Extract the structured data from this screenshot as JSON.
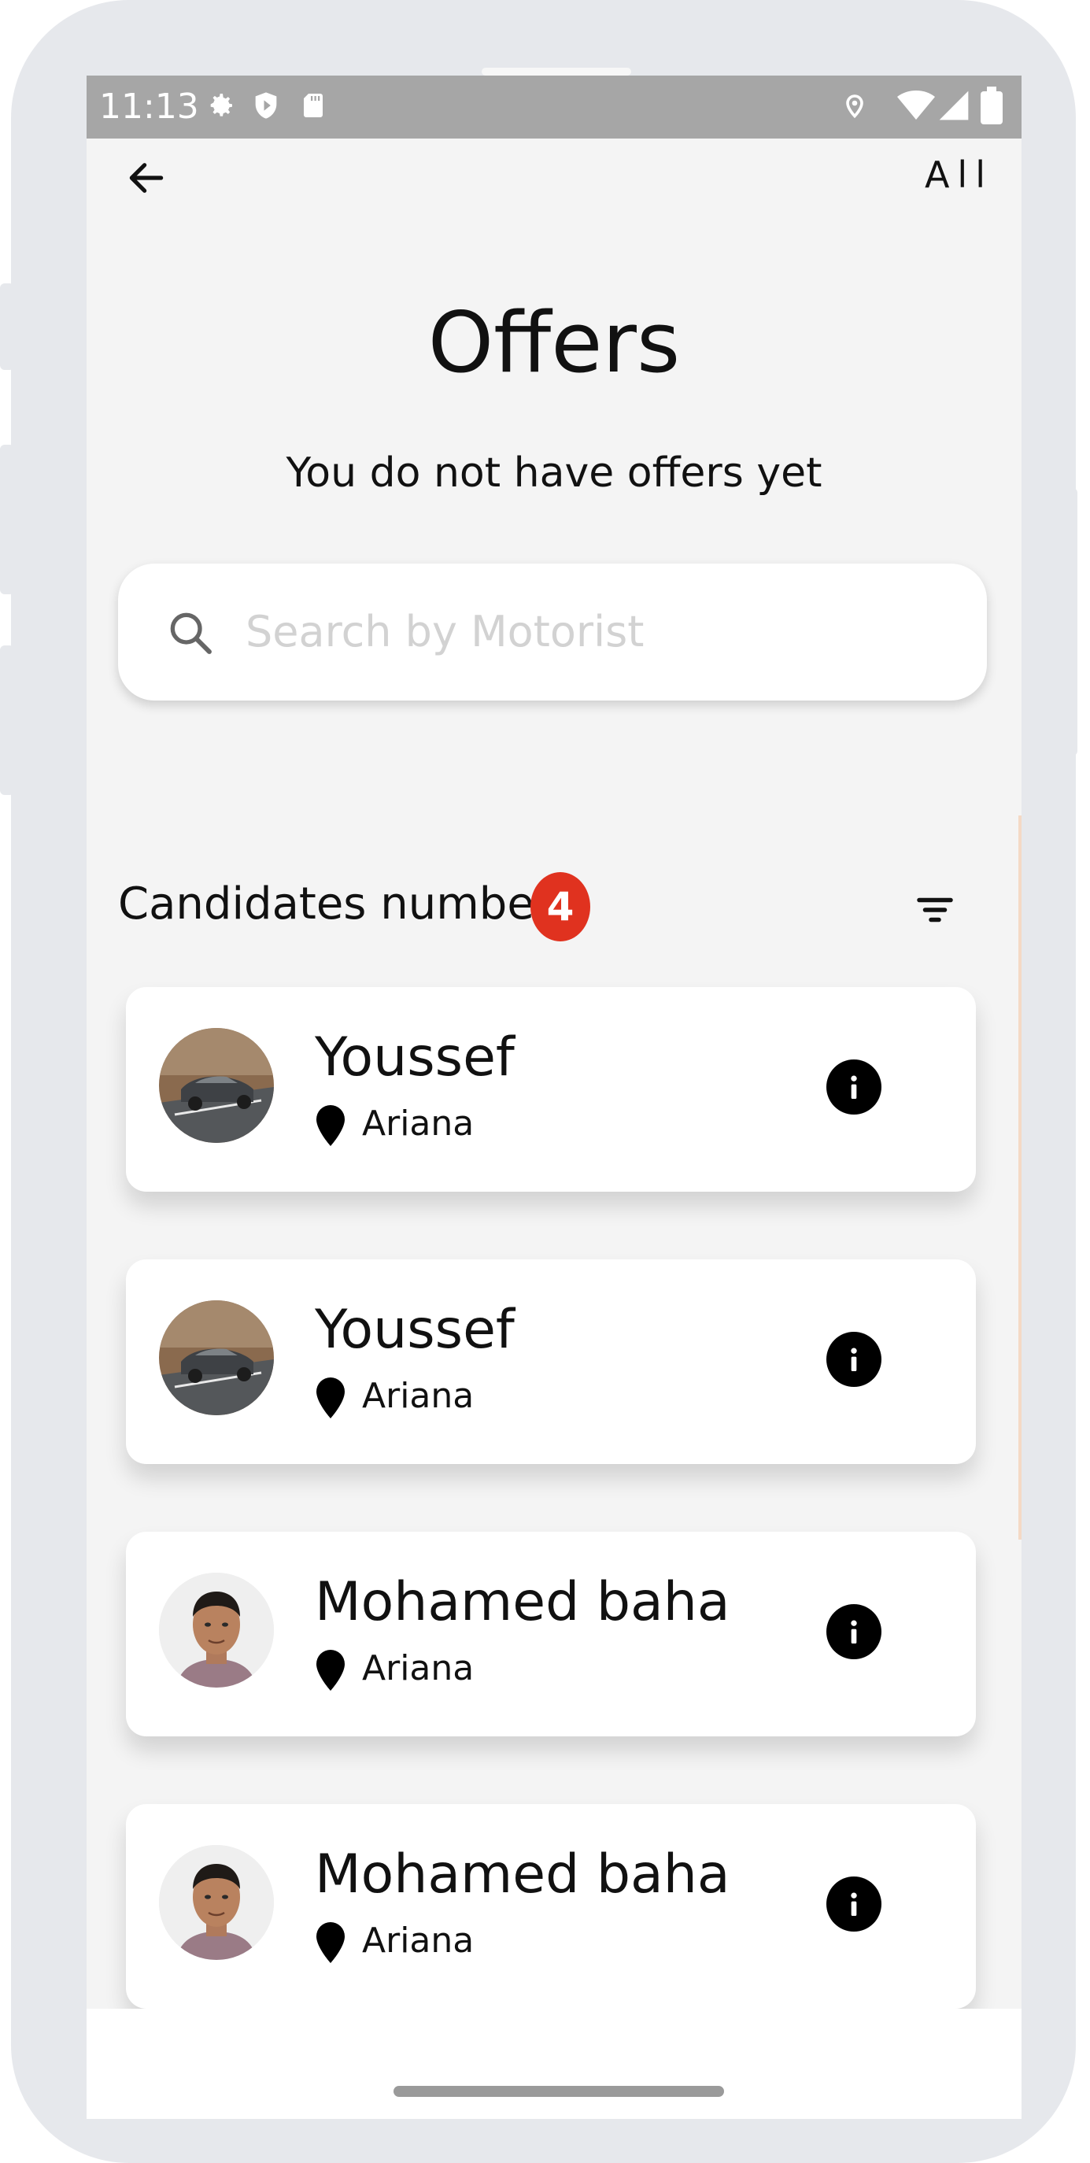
{
  "status_bar": {
    "time": "11:13"
  },
  "header": {
    "all_label": "All",
    "title": "Offers",
    "subtitle": "You do not have offers yet"
  },
  "search": {
    "placeholder": "Search by Motorist"
  },
  "candidates": {
    "label": "Candidates number",
    "count": "4"
  },
  "offers": [
    {
      "name": "Youssef",
      "location": "Ariana",
      "avatar": "car-photo"
    },
    {
      "name": "Youssef",
      "location": "Ariana",
      "avatar": "car-photo"
    },
    {
      "name": "Mohamed baha",
      "location": "Ariana",
      "avatar": "person-photo"
    },
    {
      "name": "Mohamed baha",
      "location": "Ariana",
      "avatar": "person-photo"
    }
  ],
  "colors": {
    "badge": "#e0321f",
    "status_bar": "#a6a6a6",
    "background": "#f4f4f4"
  },
  "icons": [
    "arrow-left-icon",
    "gear-icon",
    "shield-icon",
    "sd-card-icon",
    "location-icon",
    "wifi-icon",
    "signal-icon",
    "battery-icon",
    "search-icon",
    "filter-icon",
    "pin-icon",
    "info-icon",
    "cursor-icon"
  ]
}
